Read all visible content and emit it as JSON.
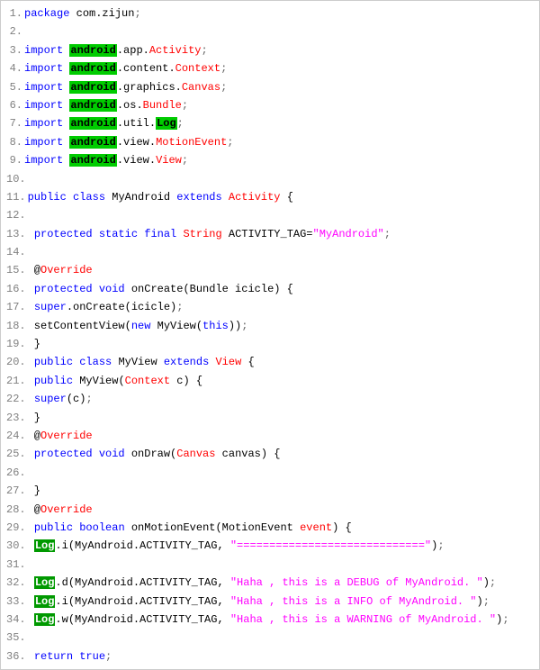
{
  "code": {
    "lines": [
      {
        "num": "1.",
        "tokens": [
          {
            "t": "package",
            "c": "kw-blue"
          },
          {
            "t": " com.zijun",
            "c": "txt"
          },
          {
            "t": ";",
            "c": "punct"
          }
        ]
      },
      {
        "num": "2.",
        "tokens": []
      },
      {
        "num": "3.",
        "tokens": [
          {
            "t": "import",
            "c": "kw-blue"
          },
          {
            "t": " ",
            "c": "txt"
          },
          {
            "t": "android",
            "c": "hl-green"
          },
          {
            "t": ".app.",
            "c": "txt"
          },
          {
            "t": "Activity",
            "c": "kw-red"
          },
          {
            "t": ";",
            "c": "punct"
          }
        ]
      },
      {
        "num": "4.",
        "tokens": [
          {
            "t": "import",
            "c": "kw-blue"
          },
          {
            "t": " ",
            "c": "txt"
          },
          {
            "t": "android",
            "c": "hl-green"
          },
          {
            "t": ".content.",
            "c": "txt"
          },
          {
            "t": "Context",
            "c": "kw-red"
          },
          {
            "t": ";",
            "c": "punct"
          }
        ]
      },
      {
        "num": "5.",
        "tokens": [
          {
            "t": "import",
            "c": "kw-blue"
          },
          {
            "t": " ",
            "c": "txt"
          },
          {
            "t": "android",
            "c": "hl-green"
          },
          {
            "t": ".graphics.",
            "c": "txt"
          },
          {
            "t": "Canvas",
            "c": "kw-red"
          },
          {
            "t": ";",
            "c": "punct"
          }
        ]
      },
      {
        "num": "6.",
        "tokens": [
          {
            "t": "import",
            "c": "kw-blue"
          },
          {
            "t": " ",
            "c": "txt"
          },
          {
            "t": "android",
            "c": "hl-green"
          },
          {
            "t": ".os.",
            "c": "txt"
          },
          {
            "t": "Bundle",
            "c": "kw-red"
          },
          {
            "t": ";",
            "c": "punct"
          }
        ]
      },
      {
        "num": "7.",
        "tokens": [
          {
            "t": "import",
            "c": "kw-blue"
          },
          {
            "t": " ",
            "c": "txt"
          },
          {
            "t": "android",
            "c": "hl-green"
          },
          {
            "t": ".util.",
            "c": "txt"
          },
          {
            "t": "Log",
            "c": "hl-green"
          },
          {
            "t": ";",
            "c": "punct"
          }
        ]
      },
      {
        "num": "8.",
        "tokens": [
          {
            "t": "import",
            "c": "kw-blue"
          },
          {
            "t": " ",
            "c": "txt"
          },
          {
            "t": "android",
            "c": "hl-green"
          },
          {
            "t": ".view.",
            "c": "txt"
          },
          {
            "t": "MotionEvent",
            "c": "kw-red"
          },
          {
            "t": ";",
            "c": "punct"
          }
        ]
      },
      {
        "num": "9.",
        "tokens": [
          {
            "t": "import",
            "c": "kw-blue"
          },
          {
            "t": " ",
            "c": "txt"
          },
          {
            "t": "android",
            "c": "hl-green"
          },
          {
            "t": ".view.",
            "c": "txt"
          },
          {
            "t": "View",
            "c": "kw-red"
          },
          {
            "t": ";",
            "c": "punct"
          }
        ]
      },
      {
        "num": "10.",
        "tokens": []
      },
      {
        "num": "11.",
        "tokens": [
          {
            "t": "public",
            "c": "kw-blue"
          },
          {
            "t": " ",
            "c": "txt"
          },
          {
            "t": "class",
            "c": "kw-blue"
          },
          {
            "t": " MyAndroid ",
            "c": "txt"
          },
          {
            "t": "extends",
            "c": "kw-blue"
          },
          {
            "t": " ",
            "c": "txt"
          },
          {
            "t": "Activity",
            "c": "kw-red"
          },
          {
            "t": " {",
            "c": "txt"
          }
        ]
      },
      {
        "num": "12.",
        "tokens": []
      },
      {
        "num": "13.",
        "tokens": [
          {
            "t": " ",
            "c": "txt"
          },
          {
            "t": "protected",
            "c": "kw-blue"
          },
          {
            "t": " ",
            "c": "txt"
          },
          {
            "t": "static",
            "c": "kw-blue"
          },
          {
            "t": " ",
            "c": "txt"
          },
          {
            "t": "final",
            "c": "kw-blue"
          },
          {
            "t": " ",
            "c": "txt"
          },
          {
            "t": "String",
            "c": "kw-red"
          },
          {
            "t": " ACTIVITY_TAG=",
            "c": "txt"
          },
          {
            "t": "\"MyAndroid\"",
            "c": "str"
          },
          {
            "t": ";",
            "c": "punct"
          }
        ]
      },
      {
        "num": "14.",
        "tokens": []
      },
      {
        "num": "15.",
        "tokens": [
          {
            "t": " @",
            "c": "txt"
          },
          {
            "t": "Override",
            "c": "kw-red"
          }
        ]
      },
      {
        "num": "16.",
        "tokens": [
          {
            "t": " ",
            "c": "txt"
          },
          {
            "t": "protected",
            "c": "kw-blue"
          },
          {
            "t": " ",
            "c": "txt"
          },
          {
            "t": "void",
            "c": "kw-blue"
          },
          {
            "t": " onCreate(Bundle icicle) {",
            "c": "txt"
          }
        ]
      },
      {
        "num": "17.",
        "tokens": [
          {
            "t": " ",
            "c": "txt"
          },
          {
            "t": "super",
            "c": "kw-blue"
          },
          {
            "t": ".onCreate(icicle)",
            "c": "txt"
          },
          {
            "t": ";",
            "c": "punct"
          }
        ]
      },
      {
        "num": "18.",
        "tokens": [
          {
            "t": " setContentView(",
            "c": "txt"
          },
          {
            "t": "new",
            "c": "kw-blue"
          },
          {
            "t": " MyView(",
            "c": "txt"
          },
          {
            "t": "this",
            "c": "kw-blue"
          },
          {
            "t": "))",
            "c": "txt"
          },
          {
            "t": ";",
            "c": "punct"
          }
        ]
      },
      {
        "num": "19.",
        "tokens": [
          {
            "t": " }",
            "c": "txt"
          }
        ]
      },
      {
        "num": "20.",
        "tokens": [
          {
            "t": " ",
            "c": "txt"
          },
          {
            "t": "public",
            "c": "kw-blue"
          },
          {
            "t": " ",
            "c": "txt"
          },
          {
            "t": "class",
            "c": "kw-blue"
          },
          {
            "t": " MyView ",
            "c": "txt"
          },
          {
            "t": "extends",
            "c": "kw-blue"
          },
          {
            "t": " ",
            "c": "txt"
          },
          {
            "t": "View",
            "c": "kw-red"
          },
          {
            "t": " {",
            "c": "txt"
          }
        ]
      },
      {
        "num": "21.",
        "tokens": [
          {
            "t": " ",
            "c": "txt"
          },
          {
            "t": "public",
            "c": "kw-blue"
          },
          {
            "t": " MyView(",
            "c": "txt"
          },
          {
            "t": "Context",
            "c": "kw-red"
          },
          {
            "t": " c) {",
            "c": "txt"
          }
        ]
      },
      {
        "num": "22.",
        "tokens": [
          {
            "t": " ",
            "c": "txt"
          },
          {
            "t": "super",
            "c": "kw-blue"
          },
          {
            "t": "(c)",
            "c": "txt"
          },
          {
            "t": ";",
            "c": "punct"
          }
        ]
      },
      {
        "num": "23.",
        "tokens": [
          {
            "t": " }",
            "c": "txt"
          }
        ]
      },
      {
        "num": "24.",
        "tokens": [
          {
            "t": " @",
            "c": "txt"
          },
          {
            "t": "Override",
            "c": "kw-red"
          }
        ]
      },
      {
        "num": "25.",
        "tokens": [
          {
            "t": " ",
            "c": "txt"
          },
          {
            "t": "protected",
            "c": "kw-blue"
          },
          {
            "t": " ",
            "c": "txt"
          },
          {
            "t": "void",
            "c": "kw-blue"
          },
          {
            "t": " onDraw(",
            "c": "txt"
          },
          {
            "t": "Canvas",
            "c": "kw-red"
          },
          {
            "t": " canvas) {",
            "c": "txt"
          }
        ]
      },
      {
        "num": "26.",
        "tokens": []
      },
      {
        "num": "27.",
        "tokens": [
          {
            "t": " }",
            "c": "txt"
          }
        ]
      },
      {
        "num": "28.",
        "tokens": [
          {
            "t": " @",
            "c": "txt"
          },
          {
            "t": "Override",
            "c": "kw-red"
          }
        ]
      },
      {
        "num": "29.",
        "tokens": [
          {
            "t": " ",
            "c": "txt"
          },
          {
            "t": "public",
            "c": "kw-blue"
          },
          {
            "t": " ",
            "c": "txt"
          },
          {
            "t": "boolean",
            "c": "kw-blue"
          },
          {
            "t": " onMotionEvent(MotionEvent ",
            "c": "txt"
          },
          {
            "t": "event",
            "c": "kw-red"
          },
          {
            "t": ") {",
            "c": "txt"
          }
        ]
      },
      {
        "num": "30.",
        "tokens": [
          {
            "t": " ",
            "c": "txt"
          },
          {
            "t": "Log",
            "c": "hl-green-dark"
          },
          {
            "t": ".i(MyAndroid.ACTIVITY_TAG, ",
            "c": "txt"
          },
          {
            "t": "\"=============================\"",
            "c": "str"
          },
          {
            "t": ")",
            "c": "txt"
          },
          {
            "t": ";",
            "c": "punct"
          }
        ]
      },
      {
        "num": "31.",
        "tokens": []
      },
      {
        "num": "32.",
        "tokens": [
          {
            "t": " ",
            "c": "txt"
          },
          {
            "t": "Log",
            "c": "hl-green-dark"
          },
          {
            "t": ".d(MyAndroid.ACTIVITY_TAG, ",
            "c": "txt"
          },
          {
            "t": "\"Haha , this is a DEBUG of MyAndroid. \"",
            "c": "str"
          },
          {
            "t": ")",
            "c": "txt"
          },
          {
            "t": ";",
            "c": "punct"
          }
        ]
      },
      {
        "num": "33.",
        "tokens": [
          {
            "t": " ",
            "c": "txt"
          },
          {
            "t": "Log",
            "c": "hl-green-dark"
          },
          {
            "t": ".i(MyAndroid.ACTIVITY_TAG, ",
            "c": "txt"
          },
          {
            "t": "\"Haha , this is a INFO of MyAndroid. \"",
            "c": "str"
          },
          {
            "t": ")",
            "c": "txt"
          },
          {
            "t": ";",
            "c": "punct"
          }
        ]
      },
      {
        "num": "34.",
        "tokens": [
          {
            "t": " ",
            "c": "txt"
          },
          {
            "t": "Log",
            "c": "hl-green-dark"
          },
          {
            "t": ".w(MyAndroid.ACTIVITY_TAG, ",
            "c": "txt"
          },
          {
            "t": "\"Haha , this is a WARNING of MyAndroid. \"",
            "c": "str"
          },
          {
            "t": ")",
            "c": "txt"
          },
          {
            "t": ";",
            "c": "punct"
          }
        ]
      },
      {
        "num": "35.",
        "tokens": []
      },
      {
        "num": "36.",
        "tokens": [
          {
            "t": " ",
            "c": "txt"
          },
          {
            "t": "return",
            "c": "kw-blue"
          },
          {
            "t": " ",
            "c": "txt"
          },
          {
            "t": "true",
            "c": "kw-blue"
          },
          {
            "t": ";",
            "c": "punct"
          }
        ]
      }
    ]
  }
}
